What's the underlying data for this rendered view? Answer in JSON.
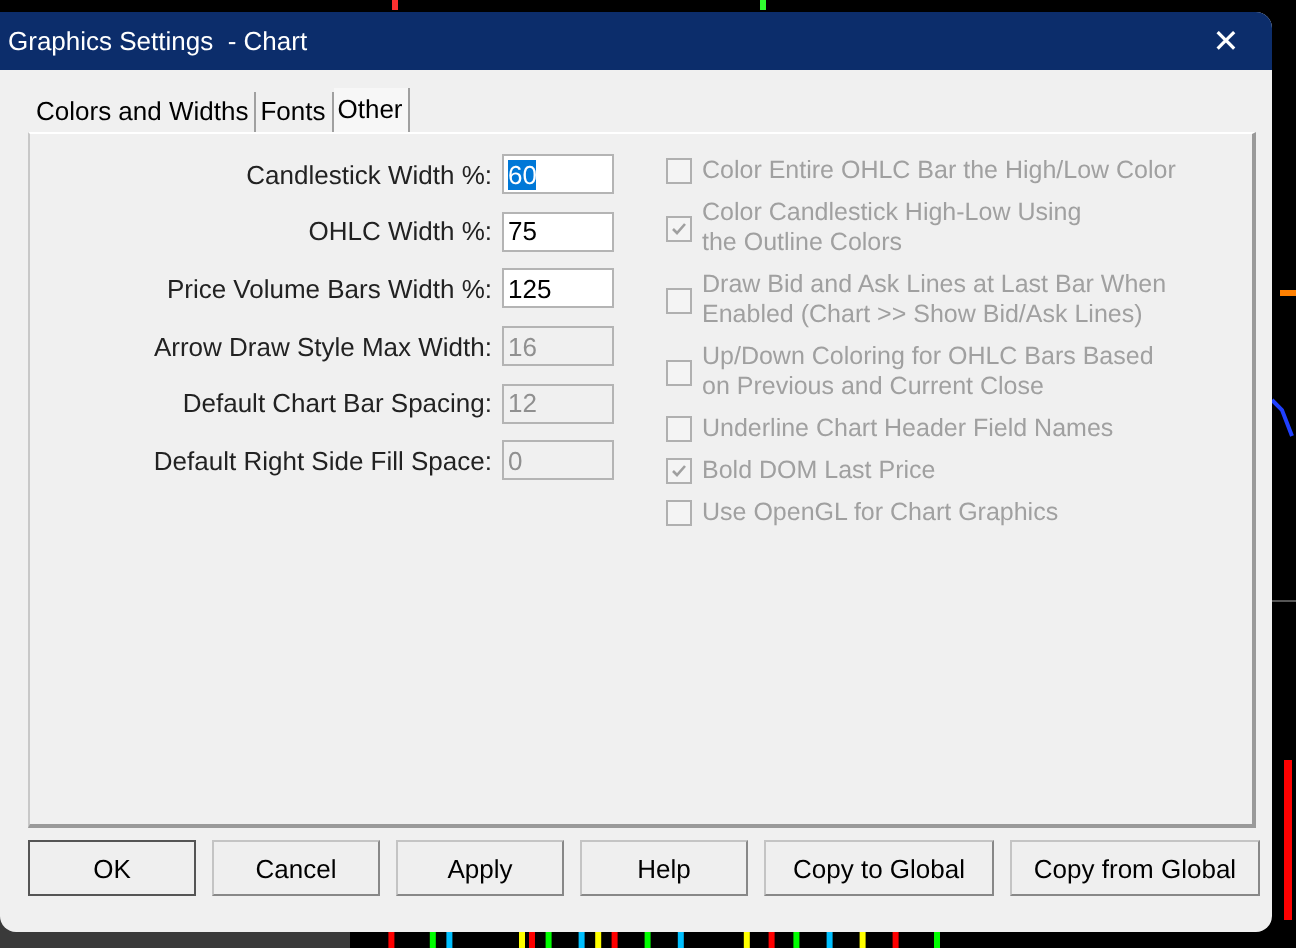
{
  "window": {
    "title": "Graphics Settings  - Chart",
    "close": "✕"
  },
  "tabs": [
    {
      "label": "Colors and Widths",
      "selected": false
    },
    {
      "label": "Fonts",
      "selected": false
    },
    {
      "label": "Other",
      "selected": true
    }
  ],
  "fields": [
    {
      "label": "Candlestick Width %:",
      "value": "60",
      "disabled": false,
      "highlighted": true
    },
    {
      "label": "OHLC Width %:",
      "value": "75",
      "disabled": false,
      "highlighted": false
    },
    {
      "label": "Price Volume Bars Width %:",
      "value": "125",
      "disabled": false,
      "highlighted": false
    },
    {
      "label": "Arrow Draw Style Max Width:",
      "value": "16",
      "disabled": true,
      "highlighted": false
    },
    {
      "label": "Default Chart Bar Spacing:",
      "value": "12",
      "disabled": true,
      "highlighted": false
    },
    {
      "label": "Default Right Side Fill Space:",
      "value": "0",
      "disabled": true,
      "highlighted": false
    }
  ],
  "options": [
    {
      "label": "Color Entire OHLC Bar the High/Low Color",
      "checked": false,
      "disabled": true
    },
    {
      "label": "Color Candlestick High-Low Using\nthe Outline Colors",
      "checked": true,
      "disabled": true
    },
    {
      "label": "Draw Bid and Ask Lines at Last Bar When\nEnabled (Chart >> Show Bid/Ask Lines)",
      "checked": false,
      "disabled": true
    },
    {
      "label": "Up/Down Coloring for OHLC Bars Based\non Previous and Current Close",
      "checked": false,
      "disabled": true
    },
    {
      "label": "Underline Chart Header Field Names",
      "checked": false,
      "disabled": true
    },
    {
      "label": "Bold DOM Last Price",
      "checked": true,
      "disabled": true
    },
    {
      "label": "Use OpenGL for Chart Graphics",
      "checked": false,
      "disabled": true
    }
  ],
  "buttons": [
    {
      "label": "OK",
      "default": true
    },
    {
      "label": "Cancel",
      "default": false
    },
    {
      "label": "Apply",
      "default": false
    },
    {
      "label": "Help",
      "default": false
    },
    {
      "label": "Copy to Global",
      "default": false
    },
    {
      "label": "Copy from Global",
      "default": false
    }
  ]
}
